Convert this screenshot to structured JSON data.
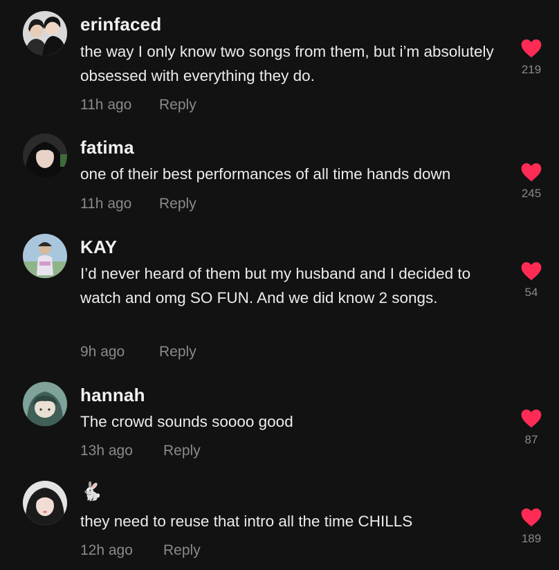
{
  "colors": {
    "background": "#121212",
    "heart": "#fe2c55",
    "muted": "#8a8a8a",
    "text": "#ececec"
  },
  "comments": [
    {
      "username": "erinfaced",
      "text": "the way I only know two songs from them, but i’m absolutely obsessed with everything they do.",
      "time": "11h ago",
      "reply_label": "Reply",
      "likes": "219",
      "liked": true,
      "heart_icon": "heart-icon"
    },
    {
      "username": "fatima",
      "text": "one of their best performances of all time hands down",
      "time": "11h ago",
      "reply_label": "Reply",
      "likes": "245",
      "liked": true,
      "heart_icon": "heart-icon"
    },
    {
      "username": "KAY",
      "text": "I’d never heard of them but my husband and I decided to watch and omg SO FUN. And we did know 2 songs.",
      "time": "9h ago",
      "reply_label": "Reply",
      "likes": "54",
      "liked": true,
      "heart_icon": "heart-icon"
    },
    {
      "username": "hannah",
      "text": "The crowd sounds soooo good",
      "time": "13h ago",
      "reply_label": "Reply",
      "likes": "87",
      "liked": true,
      "heart_icon": "heart-icon"
    },
    {
      "username": "🐇",
      "text": "they need to reuse that intro all the time CHILLS",
      "time": "12h ago",
      "reply_label": "Reply",
      "likes": "189",
      "liked": true,
      "heart_icon": "heart-icon"
    }
  ]
}
